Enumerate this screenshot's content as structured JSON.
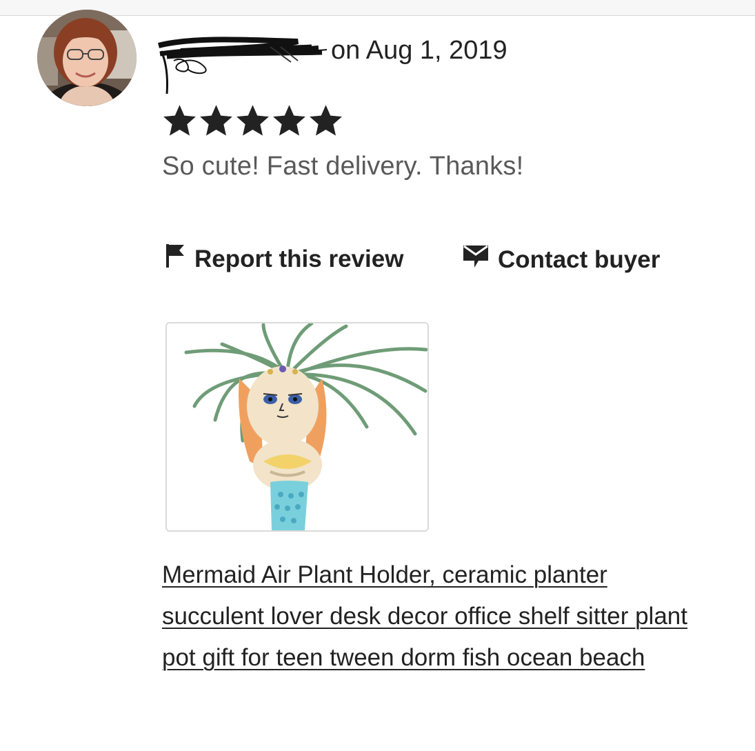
{
  "review": {
    "date_text": "on Aug 1, 2019",
    "rating": 5,
    "rating_max": 5,
    "text": "So cute! Fast delivery. Thanks!"
  },
  "actions": {
    "report_label": "Report this review",
    "contact_label": "Contact buyer"
  },
  "listing": {
    "title": "Mermaid Air Plant Holder, ceramic planter succulent lover desk decor office shelf sitter plant pot gift for teen tween dorm fish ocean beach"
  },
  "icons": {
    "report": "flag-icon",
    "contact": "envelope-icon",
    "star": "star-icon"
  },
  "colors": {
    "text": "#222222",
    "review_text": "#595959",
    "thumb_border": "#dadada"
  }
}
